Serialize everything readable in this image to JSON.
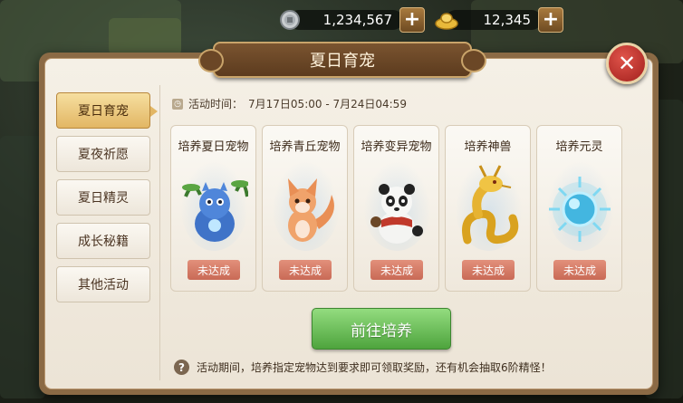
{
  "currency": {
    "silver": {
      "icon": "silver-coin-icon",
      "value": "1,234,567"
    },
    "gold": {
      "icon": "gold-ingot-icon",
      "value": "12,345"
    },
    "add_label": "+"
  },
  "dialog": {
    "title": "夏日育宠",
    "close_label": "✕"
  },
  "sidebar": {
    "items": [
      {
        "label": "夏日育宠",
        "active": true
      },
      {
        "label": "夏夜祈愿",
        "active": false
      },
      {
        "label": "夏日精灵",
        "active": false
      },
      {
        "label": "成长秘籍",
        "active": false
      },
      {
        "label": "其他活动",
        "active": false
      }
    ]
  },
  "event": {
    "time_label": "活动时间：",
    "time_range": "7月17日05:00 - 7月24日04:59"
  },
  "cards": [
    {
      "title": "培养夏日宠物",
      "icon": "blue-dragon-pet-icon",
      "status": "未达成"
    },
    {
      "title": "培养青丘宠物",
      "icon": "fox-pet-icon",
      "status": "未达成"
    },
    {
      "title": "培养变异宠物",
      "icon": "panda-pet-icon",
      "status": "未达成"
    },
    {
      "title": "培养神兽",
      "icon": "golden-dragon-icon",
      "status": "未达成"
    },
    {
      "title": "培养元灵",
      "icon": "spirit-orb-icon",
      "status": "未达成"
    }
  ],
  "action": {
    "go_label": "前往培养"
  },
  "footer": {
    "note": "活动期间，培养指定宠物达到要求即可领取奖励，还有机会抽取6阶精怪！",
    "help_label": "?"
  },
  "colors": {
    "accent_green": "#4ea43d",
    "status_red": "#c96a56",
    "active_tab": "#e2b664"
  }
}
